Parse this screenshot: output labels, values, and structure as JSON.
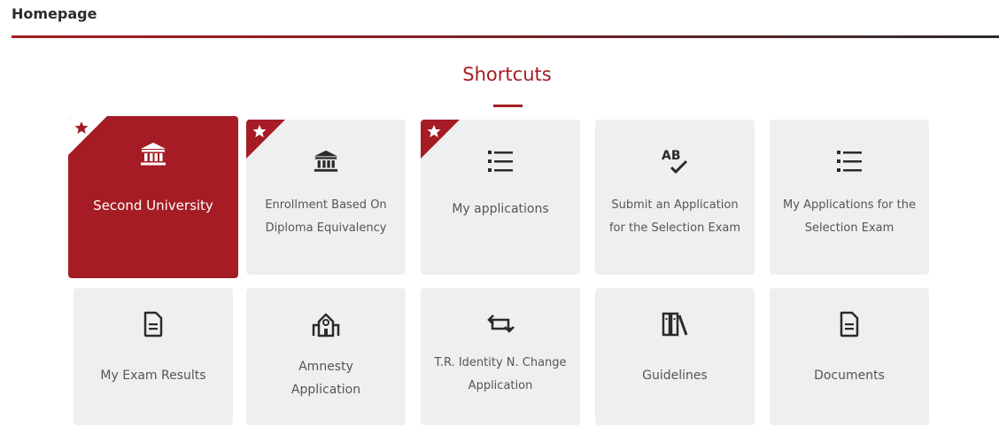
{
  "header": {
    "title": "Homepage"
  },
  "shortcuts": {
    "title": "Shortcuts",
    "tiles": [
      {
        "label": "Second University",
        "icon": "bank-icon",
        "starred": true,
        "active": true
      },
      {
        "label": "Enrollment Based On Diploma Equivalency",
        "icon": "bank-icon",
        "starred": true,
        "active": false
      },
      {
        "label": "My applications",
        "icon": "list-icon",
        "starred": true,
        "active": false
      },
      {
        "label": "Submit an Application for the Selection Exam",
        "icon": "spellcheck-icon",
        "starred": false,
        "active": false
      },
      {
        "label": "My Applications for the Selection Exam",
        "icon": "list-icon",
        "starred": false,
        "active": false
      },
      {
        "label": "My Exam Results",
        "icon": "document-icon",
        "starred": false,
        "active": false
      },
      {
        "label": "Amnesty Application",
        "icon": "school-building-icon",
        "starred": false,
        "active": false
      },
      {
        "label": "T.R. Identity N. Change Application",
        "icon": "swap-arrows-icon",
        "starred": false,
        "active": false
      },
      {
        "label": "Guidelines",
        "icon": "books-icon",
        "starred": false,
        "active": false
      },
      {
        "label": "Documents",
        "icon": "document-icon",
        "starred": false,
        "active": false
      }
    ]
  },
  "colors": {
    "accent": "#a51c24",
    "tile_bg": "#efefef",
    "text": "#555555"
  }
}
